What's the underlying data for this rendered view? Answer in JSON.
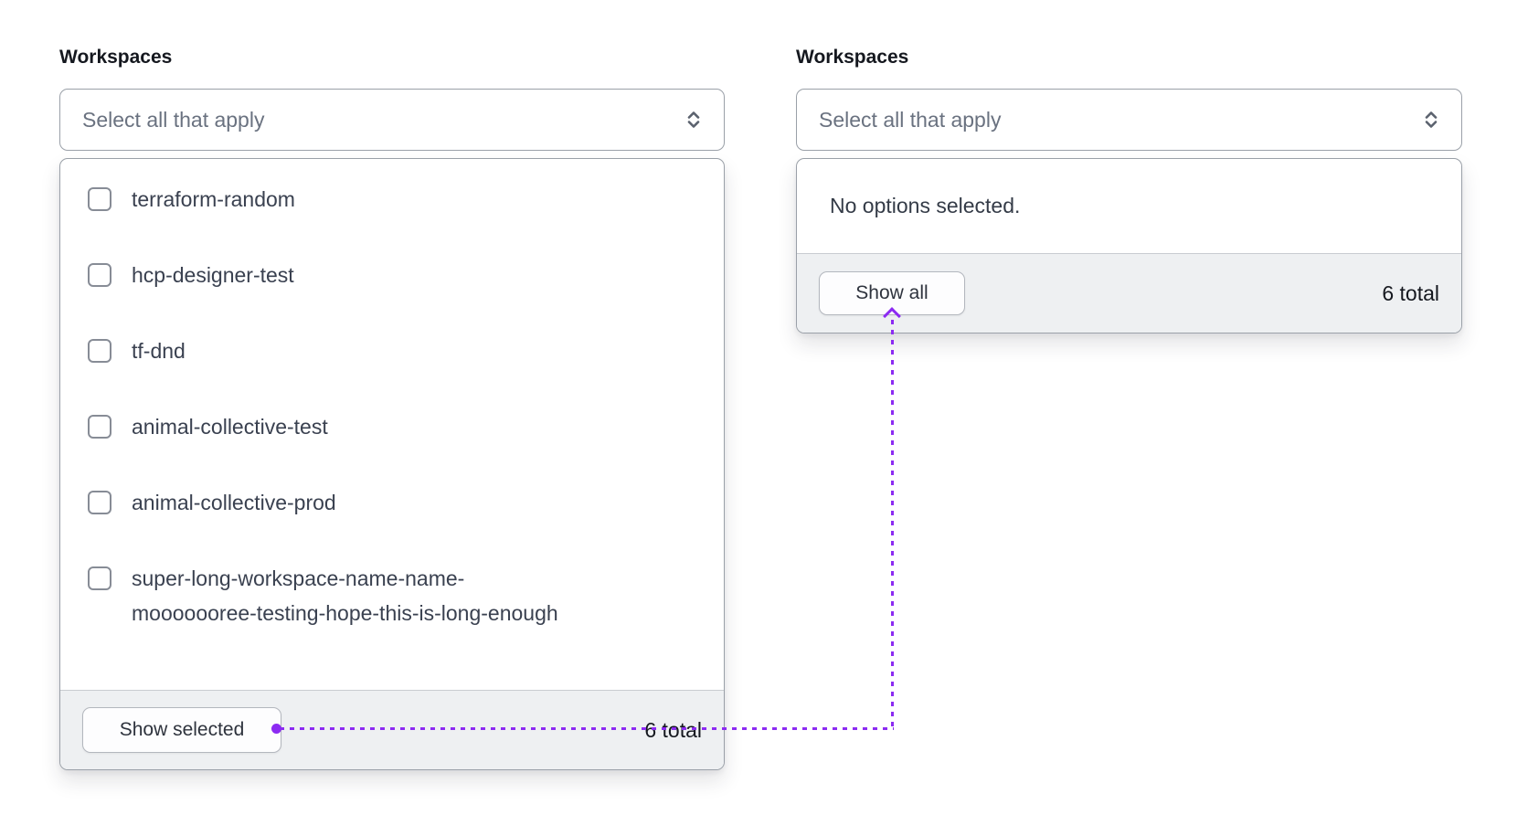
{
  "left_combobox": {
    "label": "Workspaces",
    "trigger": {
      "placeholder": "Select all that apply",
      "icon": "caret-sort-icon"
    },
    "dropdown": {
      "options": [
        {
          "label": "terraform-random",
          "checked": false
        },
        {
          "label": "hcp-designer-test",
          "checked": false
        },
        {
          "label": "tf-dnd",
          "checked": false
        },
        {
          "label": "animal-collective-test",
          "checked": false
        },
        {
          "label": "animal-collective-prod",
          "checked": false
        },
        {
          "label": "super-long-workspace-name-name-mooooooree-testing-hope-this-is-long-enough",
          "checked": false
        }
      ],
      "footer": {
        "button_label": "Show selected",
        "total_label": "6 total"
      }
    }
  },
  "right_combobox": {
    "label": "Workspaces",
    "trigger": {
      "placeholder": "Select all that apply",
      "icon": "caret-sort-icon"
    },
    "dropdown": {
      "empty_message": "No options selected.",
      "footer": {
        "button_label": "Show all",
        "total_label": "6 total"
      }
    }
  },
  "annotation": {
    "type": "dotted-connector",
    "color": "#8c2bf2",
    "from": "show-selected-button",
    "to": "show-all-button"
  }
}
